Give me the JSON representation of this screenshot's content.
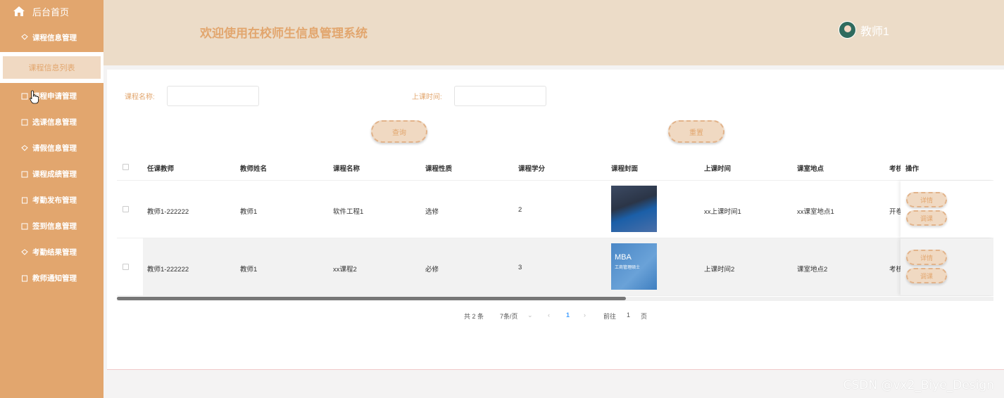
{
  "sidebar": {
    "home_label": "后台首页",
    "items": [
      {
        "label": "课程信息管理"
      },
      {
        "label": "课程信息列表"
      },
      {
        "label": "课程申请管理"
      },
      {
        "label": "选课信息管理"
      },
      {
        "label": "请假信息管理"
      },
      {
        "label": "课程成绩管理"
      },
      {
        "label": "考勤发布管理"
      },
      {
        "label": "签到信息管理"
      },
      {
        "label": "考勤结果管理"
      },
      {
        "label": "教师通知管理"
      }
    ]
  },
  "header": {
    "title": "欢迎使用在校师生信息管理系统",
    "user_name": "教师1"
  },
  "search": {
    "course_name_label": "课程名称:",
    "time_label": "上课时间:",
    "course_name_value": "",
    "time_value": "",
    "query_button": "查询",
    "reset_button": "重置"
  },
  "table": {
    "headers": [
      "任课教师",
      "教师姓名",
      "课程名称",
      "课程性质",
      "课程学分",
      "课程封面",
      "上课时间",
      "课室地点",
      "考核",
      "操作"
    ],
    "rows": [
      {
        "teacher_account": "教师1-222222",
        "teacher_name": "教师1",
        "course_name": "软件工程1",
        "nature": "选修",
        "credit": "2",
        "time": "xx上课时间1",
        "room": "xx课室地点1",
        "exam": "开卷"
      },
      {
        "teacher_account": "教师1-222222",
        "teacher_name": "教师1",
        "course_name": "xx课程2",
        "nature": "必修",
        "credit": "3",
        "time": "上课时间2",
        "room": "课室地点2",
        "exam": "考核"
      }
    ],
    "thumb2_text": "MBA",
    "thumb2_sub": "工商管理硕士",
    "detail_button": "详情",
    "adjust_button": "调课"
  },
  "pagination": {
    "total": "共 2 条",
    "page_size": "7条/页",
    "prev": "‹",
    "current": "1",
    "next": "›",
    "goto_label": "前往",
    "goto_value": "1",
    "page_unit": "页"
  },
  "watermark": "CSDN @vx2_Biye_Design",
  "colors": {
    "primary": "#e2a66e",
    "header_bg": "#ecdcc8",
    "button_bg": "#f0d9c2"
  }
}
